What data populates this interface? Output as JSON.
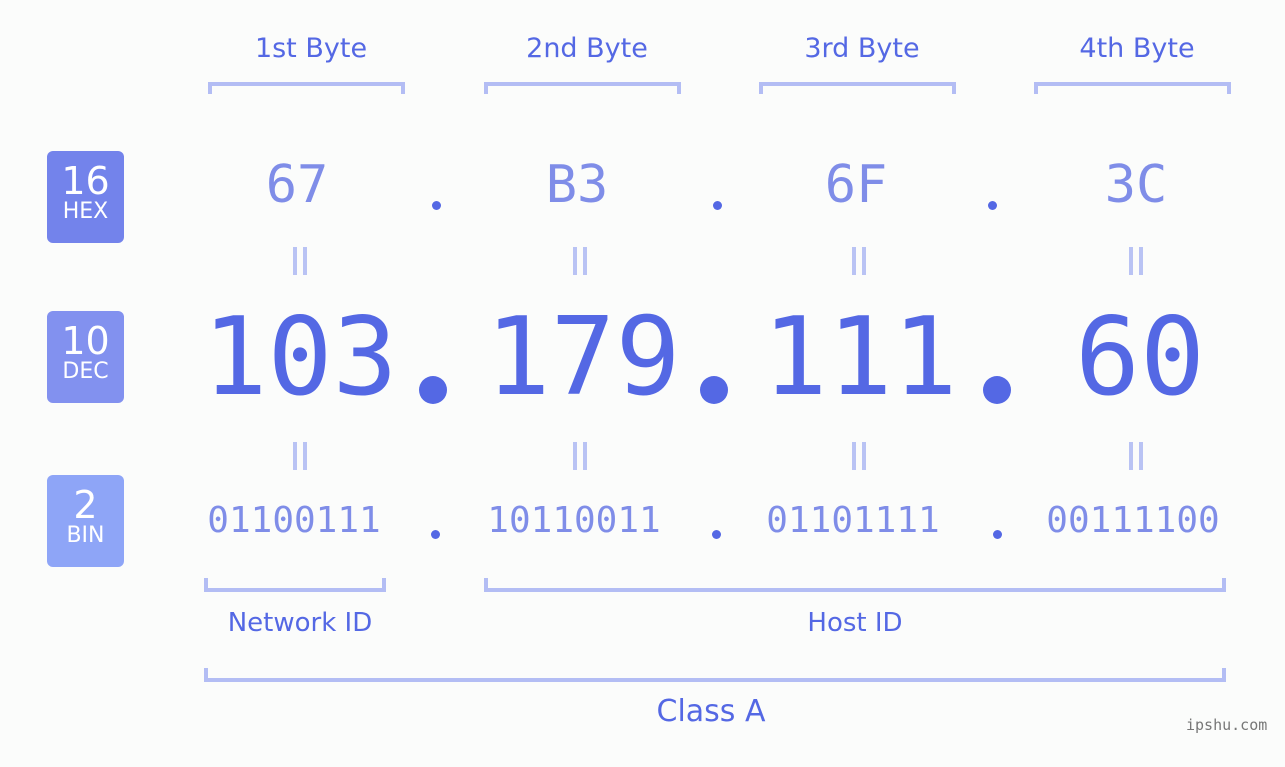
{
  "byte_headers": [
    "1st Byte",
    "2nd Byte",
    "3rd Byte",
    "4th Byte"
  ],
  "rows": {
    "hex": {
      "base": "16",
      "label": "HEX",
      "color": "#7383eb",
      "values": [
        "67",
        "B3",
        "6F",
        "3C"
      ]
    },
    "dec": {
      "base": "10",
      "label": "DEC",
      "color": "#8291ef",
      "values": [
        "103",
        "179",
        "111",
        "60"
      ]
    },
    "bin": {
      "base": "2",
      "label": "BIN",
      "color": "#8ea5f7",
      "values": [
        "01100111",
        "10110011",
        "01101111",
        "00111100"
      ]
    }
  },
  "separator": ".",
  "groups": {
    "network_id": "Network ID",
    "host_id": "Host ID",
    "class": "Class A"
  },
  "watermark": "ipshu.com"
}
